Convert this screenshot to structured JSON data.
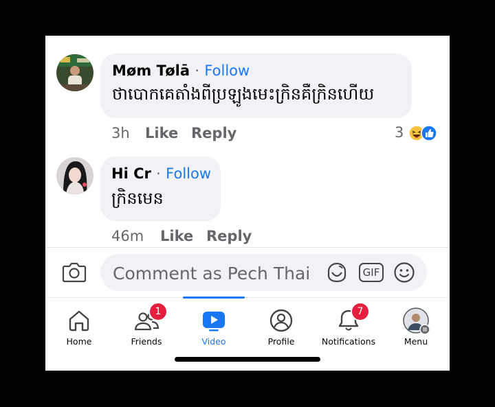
{
  "comments": [
    {
      "author": "Møm Tølā",
      "separator": "·",
      "follow_label": "Follow",
      "text": "ថាបោកគេតាំងពីប្រឡូងមេះក្រិនគឺក្រិនហើយ",
      "time": "3h",
      "like_label": "Like",
      "reply_label": "Reply",
      "reaction_count": "3"
    },
    {
      "author": "Hi Cr",
      "separator": "·",
      "follow_label": "Follow",
      "text": "ក្រិនមេន",
      "time": "46m",
      "like_label": "Like",
      "reply_label": "Reply"
    }
  ],
  "composer": {
    "placeholder": "Comment as Pech Thai",
    "gif_label": "GIF"
  },
  "nav": {
    "items": [
      {
        "label": "Home",
        "icon": "home-icon"
      },
      {
        "label": "Friends",
        "icon": "friends-icon",
        "badge": "1"
      },
      {
        "label": "Video",
        "icon": "video-icon",
        "active": true
      },
      {
        "label": "Profile",
        "icon": "profile-icon"
      },
      {
        "label": "Notifications",
        "icon": "bell-icon",
        "badge": "7"
      },
      {
        "label": "Menu",
        "icon": "menu-avatar-icon"
      }
    ]
  },
  "colors": {
    "accent": "#1877f2",
    "badge": "#e41e3f",
    "bubble": "#f0f2f5",
    "meta_text": "#65676b"
  }
}
